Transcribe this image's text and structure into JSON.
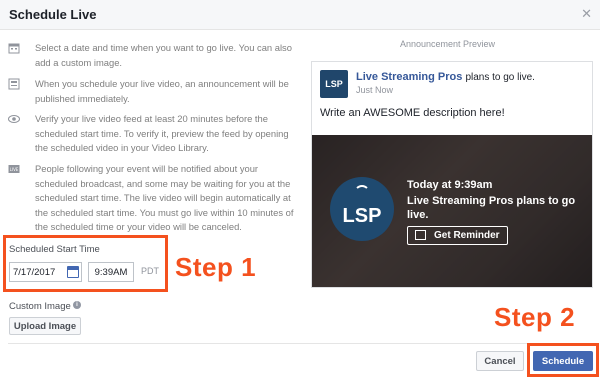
{
  "dialog": {
    "title": "Schedule Live",
    "close_icon": "close-icon"
  },
  "info": [
    {
      "icon": "calendar-icon",
      "text": "Select a date and time when you want to go live. You can also add a custom image."
    },
    {
      "icon": "announcement-icon",
      "text": "When you schedule your live video, an announcement will be published immediately."
    },
    {
      "icon": "eye-icon",
      "text": "Verify your live video feed at least 20 minutes before the scheduled start time. To verify it, preview the feed by opening the scheduled video in your Video Library."
    },
    {
      "icon": "live-icon",
      "text": "People following your event will be notified about your scheduled broadcast, and some may be waiting for you at the scheduled start time. The live video will begin automatically at the scheduled start time. You must go live within 10 minutes of the scheduled time or your video will be canceled."
    }
  ],
  "schedule": {
    "label": "Scheduled Start Time",
    "date": "7/17/2017",
    "time": "9:39AM",
    "timezone": "PDT"
  },
  "custom_image": {
    "label": "Custom Image",
    "upload_label": "Upload Image"
  },
  "annotations": {
    "step1": "Step 1",
    "step2": "Step 2",
    "color": "#f4511e"
  },
  "footer": {
    "cancel_label": "Cancel",
    "schedule_label": "Schedule"
  },
  "preview": {
    "label": "Announcement Preview",
    "logo_text": "LSP",
    "page_name": "Live Streaming Pros",
    "action": "plans to go live.",
    "timestamp": "Just Now",
    "description": "Write an AWESOME description here!",
    "banner_time": "Today at 9:39am",
    "banner_text": "Live Streaming Pros plans to go live.",
    "reminder_label": "Get Reminder"
  },
  "colors": {
    "accent": "#4267b2",
    "link": "#365899",
    "logo_bg": "#20466b"
  }
}
